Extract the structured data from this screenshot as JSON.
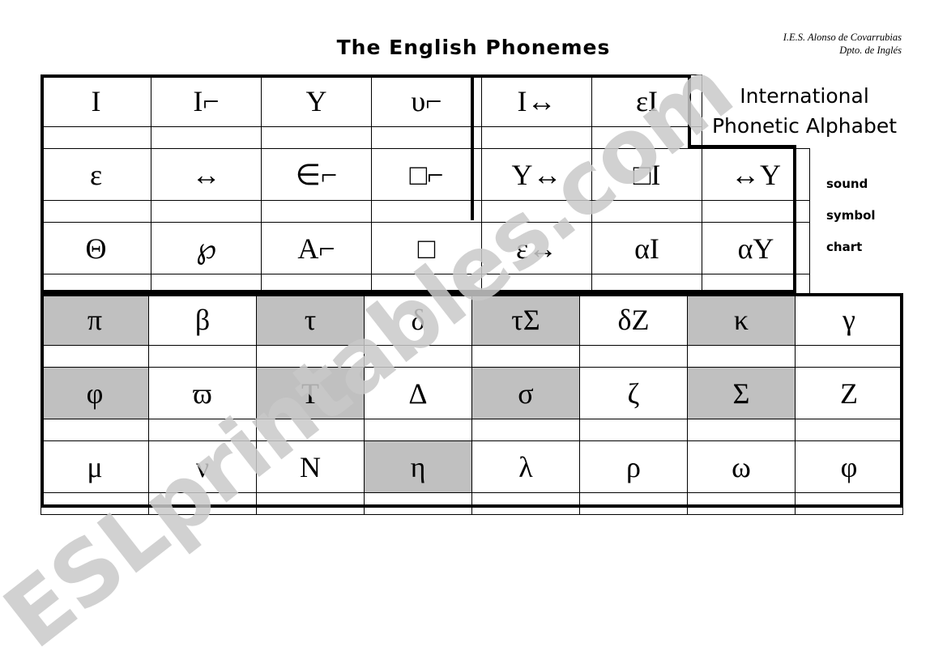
{
  "header": {
    "title": "The English Phonemes",
    "school_line1": "I.E.S. Alonso de Covarrubias",
    "school_line2": "Dpto. de Inglés"
  },
  "side_panel": {
    "heading_line1": "International",
    "heading_line2": "Phonetic Alphabet",
    "label_sound": "sound",
    "label_symbol": "symbol",
    "label_chart": "chart"
  },
  "watermark": {
    "text": "ESLprintables.com"
  },
  "colors": {
    "shade": "#c0c0c0",
    "border": "#000000",
    "background": "#ffffff",
    "watermark": "#c9c9c9"
  },
  "vowel_table": {
    "rows": [
      {
        "cells": [
          {
            "text": "I",
            "shaded": false
          },
          {
            "text": "I⌐",
            "shaded": false
          },
          {
            "text": "Y",
            "shaded": false
          },
          {
            "text": "υ⌐",
            "shaded": false
          },
          {
            "text": "I↔",
            "shaded": false
          },
          {
            "text": "εI",
            "shaded": false
          },
          {
            "text": "",
            "shaded": false,
            "hidden": true
          }
        ]
      },
      {
        "cells": [
          {
            "text": "ε",
            "shaded": false
          },
          {
            "text": "↔",
            "shaded": false
          },
          {
            "text": "∈⌐",
            "shaded": false
          },
          {
            "text": "□⌐",
            "shaded": false
          },
          {
            "text": "Y↔",
            "shaded": false
          },
          {
            "text": "□I",
            "shaded": false
          },
          {
            "text": "↔Y",
            "shaded": false
          }
        ]
      },
      {
        "cells": [
          {
            "text": "Θ",
            "shaded": false
          },
          {
            "text": "℘",
            "shaded": false
          },
          {
            "text": "A⌐",
            "shaded": false
          },
          {
            "text": "□",
            "shaded": false
          },
          {
            "text": "ε↔",
            "shaded": false
          },
          {
            "text": "αI",
            "shaded": false
          },
          {
            "text": "αY",
            "shaded": false
          }
        ]
      }
    ]
  },
  "consonant_table": {
    "rows": [
      {
        "cells": [
          {
            "text": "π",
            "shaded": true
          },
          {
            "text": "β",
            "shaded": false
          },
          {
            "text": "τ",
            "shaded": true
          },
          {
            "text": "δ",
            "shaded": false
          },
          {
            "text": "τΣ",
            "shaded": true
          },
          {
            "text": "δZ",
            "shaded": false
          },
          {
            "text": "κ",
            "shaded": true
          },
          {
            "text": "γ",
            "shaded": false
          }
        ]
      },
      {
        "cells": [
          {
            "text": "φ",
            "shaded": true
          },
          {
            "text": "ϖ",
            "shaded": false
          },
          {
            "text": "T",
            "shaded": true
          },
          {
            "text": "Δ",
            "shaded": false
          },
          {
            "text": "σ",
            "shaded": true
          },
          {
            "text": "ζ",
            "shaded": false
          },
          {
            "text": "Σ",
            "shaded": true
          },
          {
            "text": "Z",
            "shaded": false
          }
        ]
      },
      {
        "cells": [
          {
            "text": "μ",
            "shaded": false
          },
          {
            "text": "ν",
            "shaded": false
          },
          {
            "text": "N",
            "shaded": false
          },
          {
            "text": "η",
            "shaded": true
          },
          {
            "text": "λ",
            "shaded": false
          },
          {
            "text": "ρ",
            "shaded": false
          },
          {
            "text": "ω",
            "shaded": false
          },
          {
            "text": "φ",
            "shaded": false
          }
        ]
      }
    ]
  }
}
